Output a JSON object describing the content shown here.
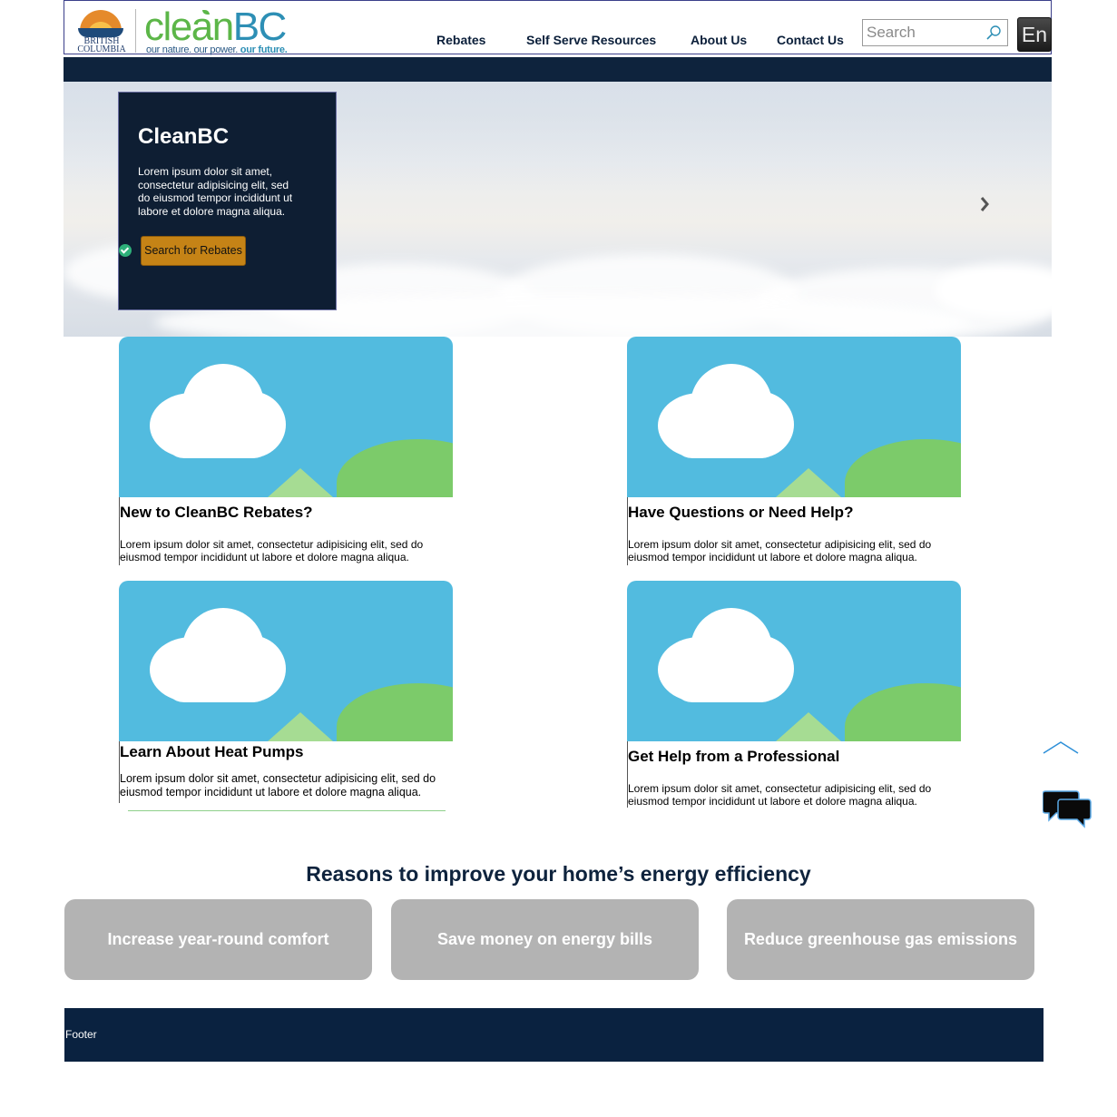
{
  "header": {
    "bc_logo_line1": "BRITISH",
    "bc_logo_line2": "COLUMBIA",
    "logo_clean": "clean",
    "logo_bc": "BC",
    "tagline_main": "our nature. our power. ",
    "tagline_highlight": "our future.",
    "nav": [
      {
        "label": "Rebates"
      },
      {
        "label": "Self Serve Resources"
      },
      {
        "label": "About Us"
      },
      {
        "label": "Contact Us"
      }
    ],
    "search_placeholder": "Search",
    "language_label": "En"
  },
  "hero": {
    "title": "CleanBC",
    "text": "Lorem ipsum dolor sit amet, consectetur adipisicing elit, sed do eiusmod tempor incididunt ut labore et dolore magna aliqua.",
    "button_label": "Search for Rebates"
  },
  "cards": [
    {
      "title": "New to CleanBC Rebates?",
      "text": "Lorem ipsum dolor sit amet, consectetur adipisicing elit, sed do eiusmod tempor incididunt ut labore et dolore magna aliqua."
    },
    {
      "title": "Have Questions or Need Help?",
      "text": "Lorem ipsum dolor sit amet, consectetur adipisicing elit, sed do eiusmod tempor incididunt ut labore et dolore magna aliqua."
    },
    {
      "title": "Learn About Heat Pumps",
      "text": "Lorem ipsum dolor sit amet, consectetur adipisicing elit, sed do eiusmod tempor incididunt ut labore et dolore magna aliqua."
    },
    {
      "title": "Get Help from a Professional",
      "text": "Lorem ipsum dolor sit amet, consectetur adipisicing elit, sed do eiusmod tempor incididunt ut labore et dolore magna aliqua."
    }
  ],
  "reasons": {
    "title": "Reasons to improve your home’s energy efficiency",
    "items": [
      {
        "label": "Increase year-round comfort"
      },
      {
        "label": "Save money on energy bills"
      },
      {
        "label": "Reduce greenhouse gas emissions"
      }
    ]
  },
  "footer": {
    "label": "Footer"
  },
  "colors": {
    "navy": "#0e233d",
    "button_gold": "#c58316",
    "card_sky": "#52bbdf",
    "reason_grey": "#b3b3b3"
  },
  "icons": [
    "bc-logo",
    "search-icon",
    "check-icon",
    "chevron-left-icon",
    "chevron-right-icon",
    "chevron-up-icon",
    "chat-icon",
    "cloud-image-icon"
  ]
}
